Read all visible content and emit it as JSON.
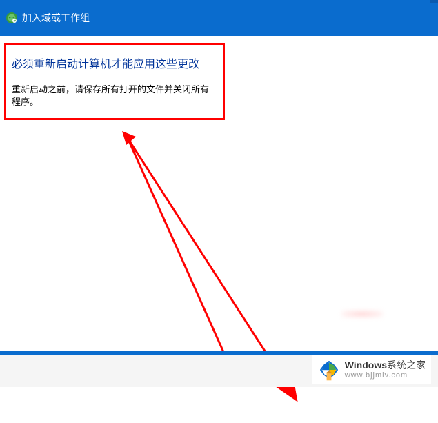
{
  "titlebar": {
    "title": "加入域或工作组"
  },
  "notice": {
    "heading": "必须重新启动计算机才能应用这些更改",
    "body": "重新启动之前，请保存所有打开的文件并关闭所有程序。"
  },
  "watermark": {
    "brand_en": "Windows",
    "brand_zh": "系统之家",
    "url": "www.bjjmlv.com"
  }
}
